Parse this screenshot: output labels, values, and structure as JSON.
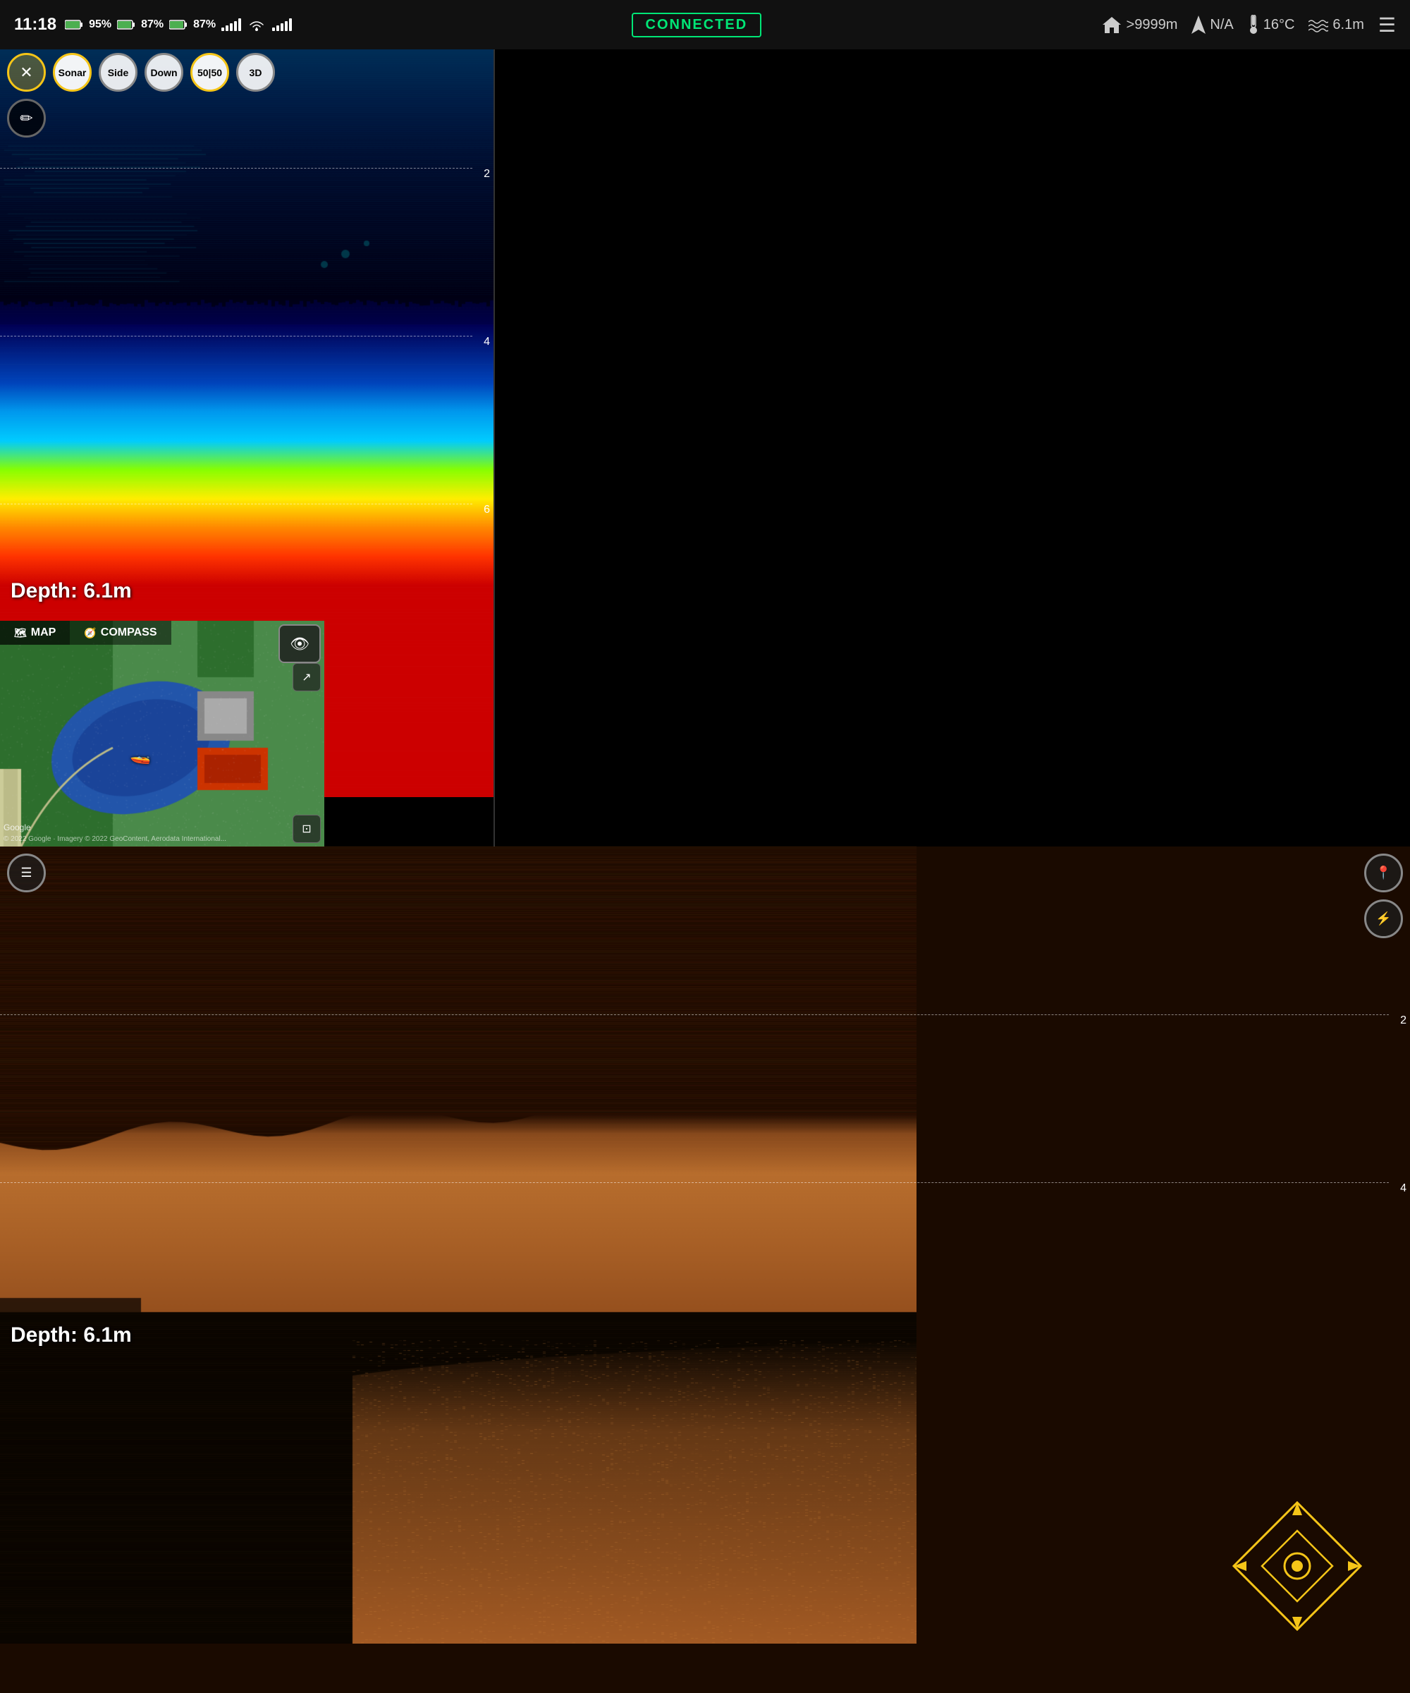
{
  "statusBar": {
    "time": "11:18",
    "battery1": "95%",
    "battery2": "87%",
    "battery3": "87%",
    "connected_label": "CONNECTED",
    "distance": ">9999m",
    "heading": "N/A",
    "temperature": "16°C",
    "altitude": "6.1m"
  },
  "leftPanel": {
    "title": "Sonar",
    "depth_label": "Depth:  6.1m",
    "depth_value": "6.1m",
    "buttons": {
      "close": "✕",
      "sonar": "Sonar",
      "side": "Side",
      "down": "Down",
      "split": "50|50",
      "three_d": "3D"
    },
    "depth_lines": [
      {
        "value": "2",
        "pos": 28
      },
      {
        "value": "4",
        "pos": 57
      },
      {
        "value": "6",
        "pos": 86
      }
    ]
  },
  "rightPanel": {
    "depth_label": "Depth:  6.1m",
    "depth_value": "6.1m",
    "depth_lines": [
      {
        "value": "2",
        "pos": 28
      },
      {
        "value": "4",
        "pos": 57
      }
    ]
  },
  "mapOverlay": {
    "map_tab": "MAP",
    "compass_tab": "COMPASS",
    "google_label": "Google",
    "copyright": "© 2022 Google · Imagery © 2022 GeoContent, Aerodata International..."
  },
  "icons": {
    "menu": "☰",
    "pencil": "✎",
    "home": "⌂",
    "navigation": "➤",
    "thermometer": "🌡",
    "signal": "≋",
    "arrow_right": "▶",
    "pin": "📍",
    "bolt": "⚡",
    "binoculars": "👀",
    "expand": "↗",
    "compress": "⊠",
    "map_icon": "🗺",
    "compass_icon": "🧭",
    "boat": "🚤"
  }
}
